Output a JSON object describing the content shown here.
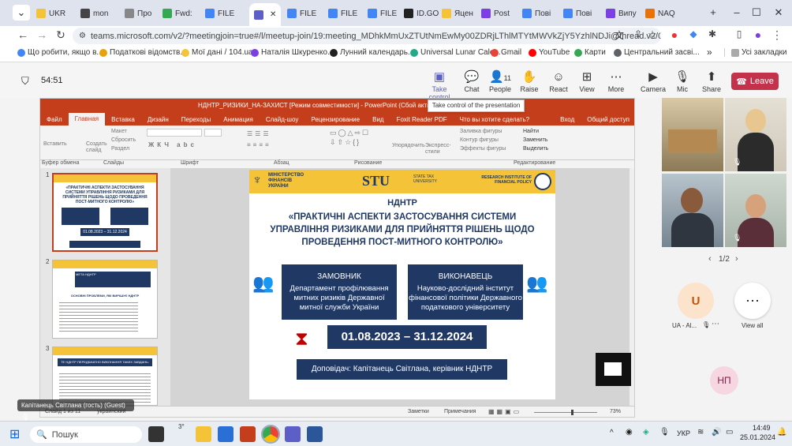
{
  "browser": {
    "tabs": [
      {
        "label": "UKR",
        "color": "#f4c338"
      },
      {
        "label": "mon",
        "color": "#444444"
      },
      {
        "label": "Про",
        "color": "#888888"
      },
      {
        "label": "Fwd:",
        "color": "#34a853"
      },
      {
        "label": "FILE",
        "color": "#4285f4"
      },
      {
        "label": "",
        "color": "#5b5fc7",
        "active": true
      },
      {
        "label": "FILE",
        "color": "#4285f4"
      },
      {
        "label": "FILE",
        "color": "#4285f4"
      },
      {
        "label": "FILE",
        "color": "#4285f4"
      },
      {
        "label": "ID.GO",
        "color": "#222222"
      },
      {
        "label": "Яцен",
        "color": "#f4c338"
      },
      {
        "label": "Post",
        "color": "#7b3fe4"
      },
      {
        "label": "Пові",
        "color": "#4285f4"
      },
      {
        "label": "Пові",
        "color": "#4285f4"
      },
      {
        "label": "Випу",
        "color": "#7b3fe4"
      },
      {
        "label": "NAQ",
        "color": "#e8710a"
      }
    ],
    "url": "teams.microsoft.com/v2/?meetingjoin=true#/l/meetup-join/19:meeting_MDhkMmUxZTUtNmEwMy00ZDRjLThlMTYtMWVkZjY5YzhlNDJi@thread.v2/0?context=...",
    "bookmarks": [
      "Що робити, якщо в...",
      "Податкові відомств...",
      "Мої дані / 104.ua",
      "Наталія Шкуренко...",
      "Лунний календарь...",
      "Universal Lunar Cale...",
      "Gmail",
      "YouTube",
      "Карти",
      "Центральний засві..."
    ],
    "all_bookmarks": "Усі закладки"
  },
  "teams": {
    "timer": "54:51",
    "buttons": {
      "take_control": "Take control",
      "chat": "Chat",
      "people": "People",
      "people_count": "11",
      "raise": "Raise",
      "react": "React",
      "view": "View",
      "more": "More",
      "camera": "Camera",
      "mic": "Mic",
      "share": "Share",
      "leave": "Leave"
    },
    "tooltip": "Take control of the presentation",
    "pager": "1/2",
    "participant_initial": "U",
    "participant_name": "UA - Al...",
    "view_all": "View all",
    "np_initials": "НП",
    "speaker_label": "Капітанець Світлана (гость) (Guest)"
  },
  "ppt": {
    "title": "НДНТР_РИЗИКИ_НА-ЗАХИСТ [Режим совместимости] - PowerPoint (Сбой активации продукта)",
    "menu": [
      "Файл",
      "Главная",
      "Вставка",
      "Дизайн",
      "Переходы",
      "Анимация",
      "Слайд-шоу",
      "Рецензирование",
      "Вид",
      "Foxit Reader PDF",
      "Что вы хотите сделать?"
    ],
    "login": "Вход",
    "share": "Общий доступ",
    "ribbon_groups": [
      "Буфер обмена",
      "Слайды",
      "Шрифт",
      "Абзац",
      "Рисование",
      "Редактирование"
    ],
    "ribbon_items": {
      "paste": "Вставить",
      "new_slide": "Создать слайд",
      "layout": "Макет",
      "reset": "Сбросить",
      "section": "Раздел",
      "arrange": "Упорядочить",
      "quick_styles": "Экспресс-стили",
      "fill": "Заливка фигуры",
      "outline": "Контур фигуры",
      "effects": "Эффекты фигуры",
      "find": "Найти",
      "replace": "Заменить",
      "select": "Выделить"
    },
    "status": {
      "slide": "Слайд 1 из 11",
      "lang": "украинский",
      "notes": "Заметки",
      "comments": "Примечания",
      "zoom": "73%"
    },
    "thumb_nums": [
      "1",
      "2",
      "3"
    ],
    "thumb2_title": "МЕТА НДНТР",
    "thumb2_sub": "ОСНОВНІ ПРОБЛЕМИ, ЯКІ ВИРІШУЄ НДНТР",
    "thumb3_title": "ТЕ НДНТР ПЕРЕДБАЧЕНО ВИКОНАННЯ ТАКИХ ЗАВДАНЬ:"
  },
  "slide": {
    "ministry": "МІНІСТЕРСТВО ФІНАНСІВ УКРАЇНИ",
    "stu": "STU",
    "stu_sub": "STATE TAX UNIVERSITY",
    "institute": "RESEARCH INSTITUTE OF FINANCIAL POLICY",
    "label": "НДНТР",
    "title": "«ПРАКТИЧНІ АСПЕКТИ ЗАСТОСУВАННЯ СИСТЕМИ УПРАВЛІННЯ РИЗИКАМИ ДЛЯ ПРИЙНЯТТЯ РІШЕНЬ ЩОДО ПРОВЕДЕННЯ ПОСТ-МИТНОГО КОНТРОЛЮ»",
    "customer_h": "ЗАМОВНИК",
    "customer": "Департамент профілювання митних ризиків Державної митної служби України",
    "contractor_h": "ВИКОНАВЕЦЬ",
    "contractor": "Науково-дослідний інститут фінансової політики Державного податкового університету",
    "dates": "01.08.2023 – 31.12.2024",
    "speaker": "Доповідач: Капітанець Світлана, керівник НДНТР"
  },
  "taskbar": {
    "search": "Пошук",
    "badge": "3°",
    "lang": "УКР",
    "time": "14:49",
    "date": "25.01.2024"
  }
}
